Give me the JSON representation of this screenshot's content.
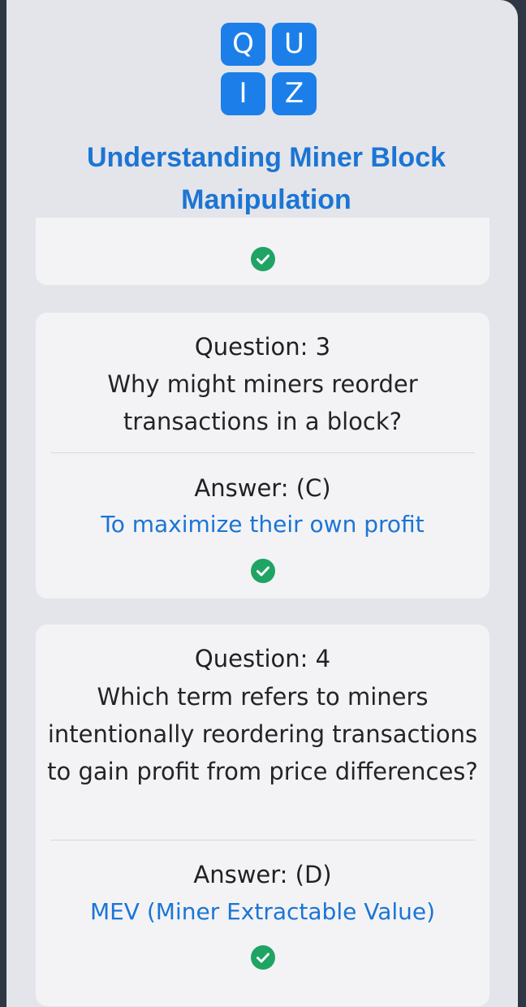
{
  "logo": {
    "tiles": [
      "Q",
      "U",
      "I",
      "Z"
    ],
    "color": "#1c7fe9"
  },
  "title": "Understanding Miner Block Manipulation",
  "colors": {
    "accent": "#1b75d4",
    "check": "#1fa463",
    "card": "#f3f3f6",
    "panel": "#e4e5ea",
    "background": "#2f3644"
  },
  "cards": [
    {
      "check_icon": "check-circle-icon"
    },
    {
      "question_heading": "Question: 3",
      "question_text": "Why might miners reorder transactions in a block?",
      "answer_heading": "Answer: (C)",
      "answer_text": "To maximize their own profit",
      "check_icon": "check-circle-icon"
    },
    {
      "question_heading": "Question: 4",
      "question_text": "Which term refers to miners intentionally reordering transactions to gain profit from price differences?",
      "answer_heading": "Answer: (D)",
      "answer_text": "MEV (Miner Extractable Value)",
      "check_icon": "check-circle-icon"
    }
  ]
}
